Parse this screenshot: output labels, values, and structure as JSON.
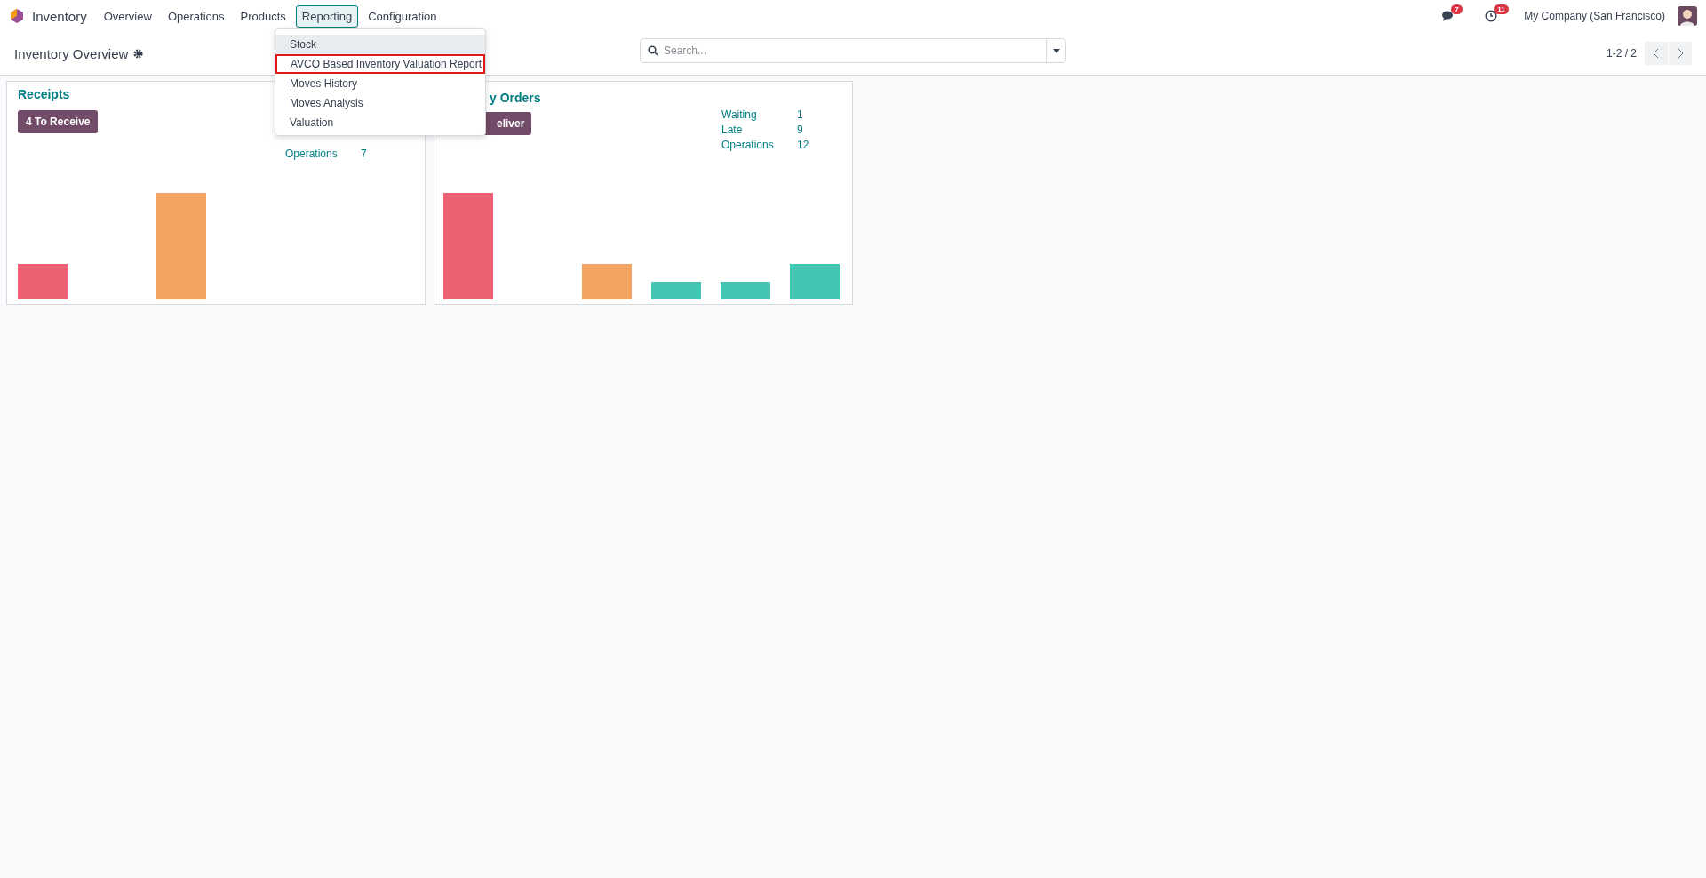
{
  "navbar": {
    "app_name": "Inventory",
    "menu": [
      {
        "label": "Overview",
        "selected": false
      },
      {
        "label": "Operations",
        "selected": false
      },
      {
        "label": "Products",
        "selected": false
      },
      {
        "label": "Reporting",
        "selected": true
      },
      {
        "label": "Configuration",
        "selected": false
      }
    ],
    "messages_badge": "7",
    "activities_badge": "11",
    "company": "My Company (San Francisco)"
  },
  "control_panel": {
    "title": "Inventory Overview",
    "search": {
      "placeholder": "Search..."
    },
    "pager": "1-2 / 2"
  },
  "reporting_menu": [
    {
      "label": "Stock",
      "selected": true,
      "outlined": false
    },
    {
      "label": "AVCO Based Inventory Valuation Report",
      "selected": false,
      "outlined": true
    },
    {
      "label": "Moves History",
      "selected": false,
      "outlined": false
    },
    {
      "label": "Moves Analysis",
      "selected": false,
      "outlined": false
    },
    {
      "label": "Valuation",
      "selected": false,
      "outlined": false
    }
  ],
  "cards": [
    {
      "title": "Receipts",
      "button": "4 To Receive",
      "stats": [
        {
          "label": "Operations",
          "value": "7"
        }
      ]
    },
    {
      "title": "y Orders",
      "button": "eliver",
      "stats": [
        {
          "label": "Waiting",
          "value": "1"
        },
        {
          "label": "Late",
          "value": "9"
        },
        {
          "label": "Operations",
          "value": "12"
        }
      ]
    }
  ]
}
